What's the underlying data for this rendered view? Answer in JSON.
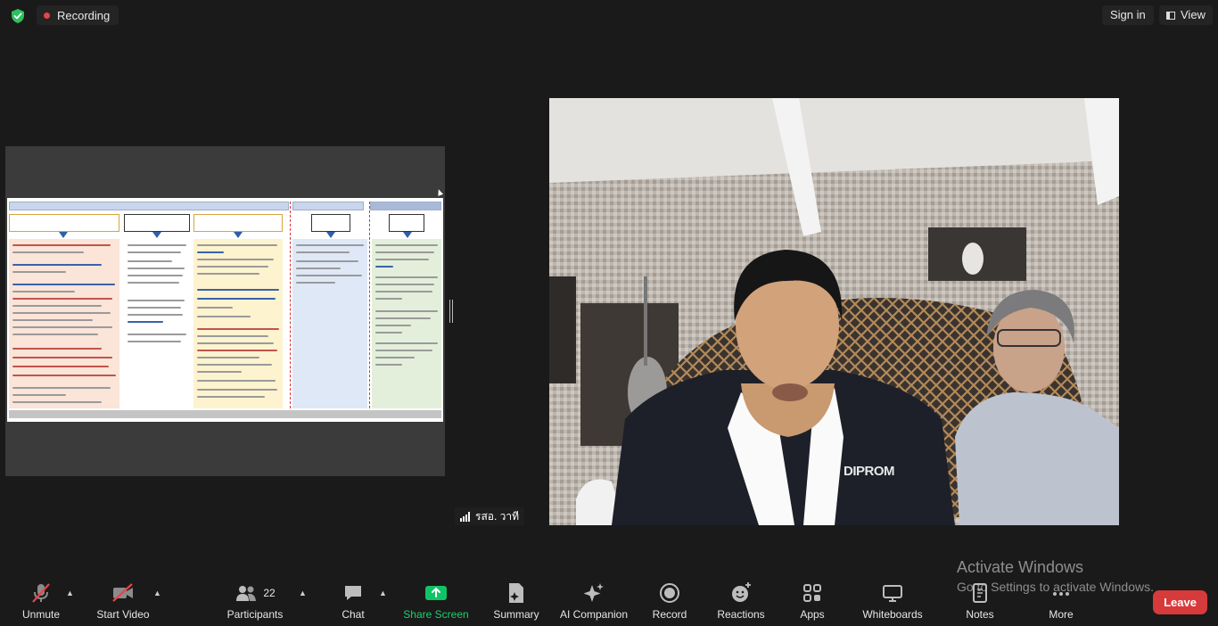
{
  "topbar": {
    "recording_label": "Recording",
    "signin_label": "Sign in",
    "view_label": "View"
  },
  "participant": {
    "name": "รสอ. วาที",
    "shirt_brand": "DIPROM"
  },
  "watermark": {
    "title": "Activate Windows",
    "subtitle": "Go to Settings to activate Windows."
  },
  "toolbar": {
    "unmute": "Unmute",
    "start_video": "Start Video",
    "participants": "Participants",
    "participants_count": "22",
    "chat": "Chat",
    "share_screen": "Share Screen",
    "summary": "Summary",
    "ai_companion": "AI Companion",
    "record": "Record",
    "reactions": "Reactions",
    "apps": "Apps",
    "whiteboards": "Whiteboards",
    "notes": "Notes",
    "more": "More",
    "leave": "Leave"
  },
  "colors": {
    "background": "#1a1a1a",
    "recording_dot": "#e8434b",
    "shield": "#2fbf5f",
    "share_screen": "#0fc466",
    "mute_slash": "#e8434b",
    "leave": "#d63a3a"
  },
  "icons": [
    "shield-check-icon",
    "record-dot-icon",
    "view-icon",
    "microphone-muted-icon",
    "video-off-icon",
    "participants-icon",
    "chat-icon",
    "share-screen-icon",
    "summary-icon",
    "ai-companion-icon",
    "record-icon",
    "reactions-icon",
    "apps-icon",
    "whiteboards-icon",
    "notes-icon",
    "more-icon",
    "signal-bars-icon"
  ]
}
